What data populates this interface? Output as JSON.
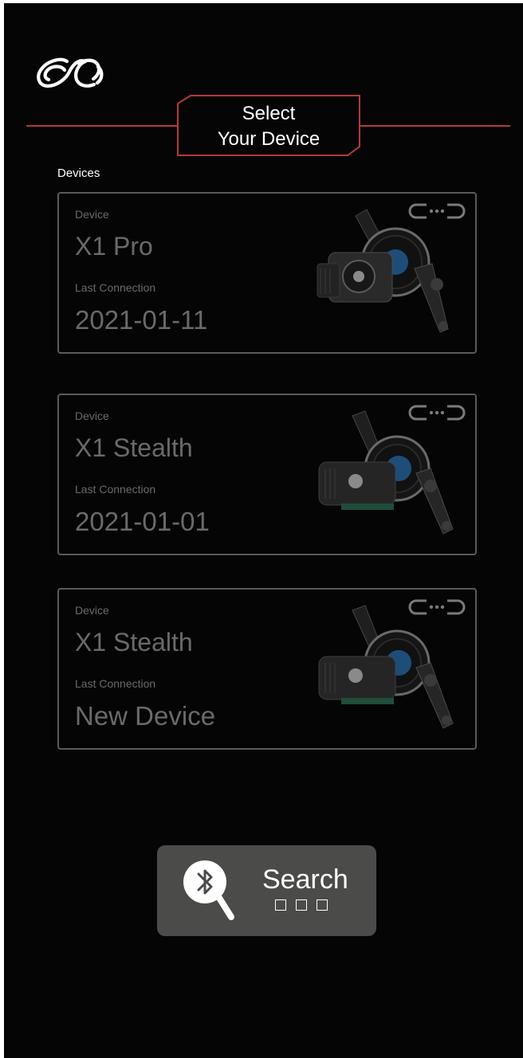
{
  "header": {
    "title_line1": "Select",
    "title_line2": "Your Device"
  },
  "section": {
    "label": "Devices"
  },
  "devices": [
    {
      "device_label": "Device",
      "name": "X1 Pro",
      "connection_label": "Last Connection",
      "connection_value": "2021-01-11",
      "icon": "link-icon",
      "image": "motor-image"
    },
    {
      "device_label": "Device",
      "name": "X1 Stealth",
      "connection_label": "Last Connection",
      "connection_value": "2021-01-01",
      "icon": "link-icon",
      "image": "motor-image"
    },
    {
      "device_label": "Device",
      "name": "X1 Stealth",
      "connection_label": "Last Connection",
      "connection_value": "New Device",
      "icon": "link-icon",
      "image": "motor-image"
    }
  ],
  "search": {
    "label": "Search",
    "icon": "bluetooth-search-icon"
  },
  "colors": {
    "background": "#050505",
    "accent": "#b33b3b",
    "card_border": "#5a5a5a",
    "button": "#4b4b49"
  }
}
